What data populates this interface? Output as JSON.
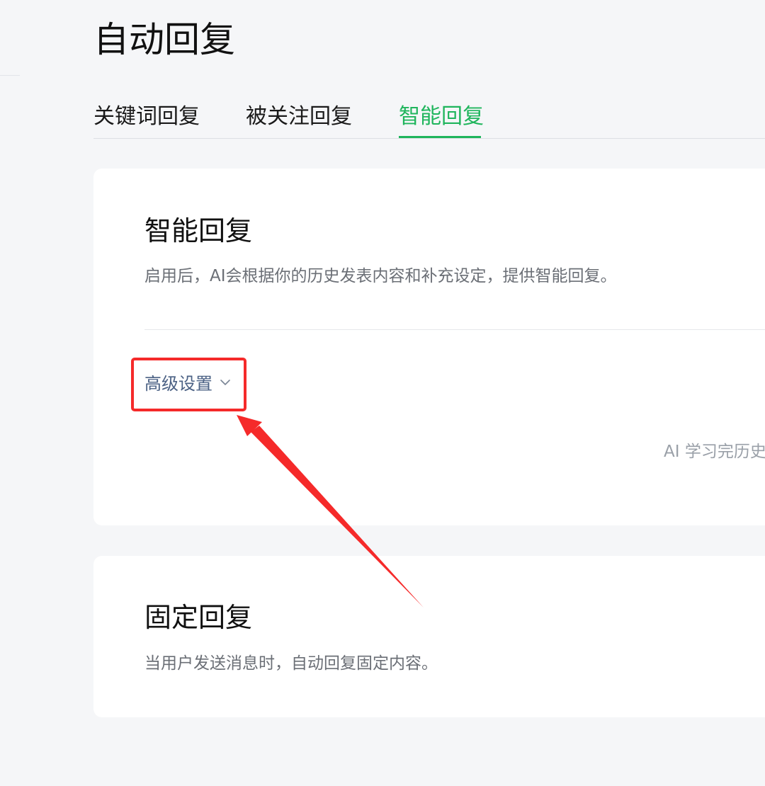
{
  "page": {
    "title": "自动回复"
  },
  "tabs": [
    {
      "label": "关键词回复",
      "active": false
    },
    {
      "label": "被关注回复",
      "active": false
    },
    {
      "label": "智能回复",
      "active": true
    }
  ],
  "smart_reply_card": {
    "title": "智能回复",
    "description": "启用后，AI会根据你的历史发表内容和补充设定，提供智能回复。",
    "advanced_settings_label": "高级设置",
    "advanced_icon": "chevron-down-icon",
    "ai_note": "AI 学习完历史"
  },
  "fixed_reply_card": {
    "title": "固定回复",
    "description": "当用户发送消息时，自动回复固定内容。"
  },
  "colors": {
    "accent_green": "#1fb55c",
    "annotation_red": "#f52a2a",
    "link_blue": "#4b6184",
    "background": "#f5f6f8"
  }
}
